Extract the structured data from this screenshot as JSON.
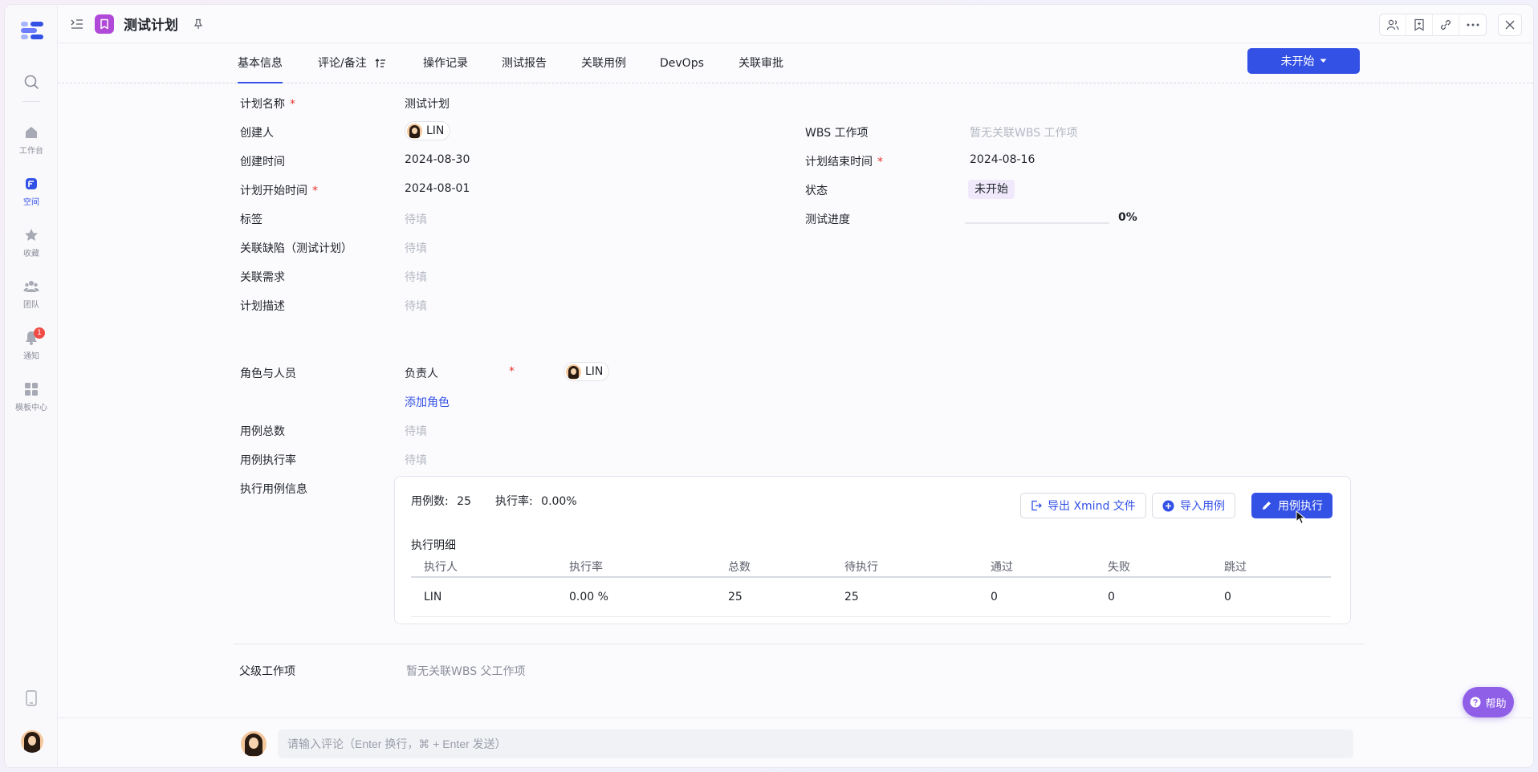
{
  "app": {
    "title": "测试计划",
    "accent_color": "#3451e6",
    "app_icon_color": "#b048d8"
  },
  "rail": {
    "items": [
      {
        "label": "工作台",
        "icon": "home-icon"
      },
      {
        "label": "空间",
        "icon": "space-icon"
      },
      {
        "label": "收藏",
        "icon": "star-icon"
      },
      {
        "label": "团队",
        "icon": "team-icon"
      },
      {
        "label": "通知",
        "icon": "bell-icon",
        "badge": "1"
      },
      {
        "label": "模板中心",
        "icon": "template-icon"
      }
    ]
  },
  "tabs": [
    {
      "label": "基本信息"
    },
    {
      "label": "评论/备注"
    },
    {
      "label": "操作记录"
    },
    {
      "label": "测试报告"
    },
    {
      "label": "关联用例"
    },
    {
      "label": "DevOps"
    },
    {
      "label": "关联审批"
    }
  ],
  "status_button": {
    "label": "未开始"
  },
  "fields_left": {
    "plan_name": {
      "label": "计划名称",
      "value": "测试计划"
    },
    "creator": {
      "label": "创建人",
      "value": "LIN"
    },
    "created_time": {
      "label": "创建时间",
      "value": "2024-08-30"
    },
    "start_time": {
      "label": "计划开始时间",
      "value": "2024-08-01"
    },
    "tags": {
      "label": "标签",
      "placeholder": "待填"
    },
    "related_bugs": {
      "label": "关联缺陷（测试计划）",
      "placeholder": "待填"
    },
    "related_reqs": {
      "label": "关联需求",
      "placeholder": "待填"
    },
    "description": {
      "label": "计划描述",
      "placeholder": "待填"
    }
  },
  "fields_right": {
    "wbs": {
      "label": "WBS 工作项",
      "placeholder": "暂无关联WBS 工作项"
    },
    "end_time": {
      "label": "计划结束时间",
      "value": "2024-08-16"
    },
    "status": {
      "label": "状态",
      "value": "未开始"
    },
    "progress": {
      "label": "测试进度",
      "value": "0%",
      "fraction": 0
    }
  },
  "roles": {
    "label": "角色与人员",
    "owner_label": "负责人",
    "owner_value": "LIN",
    "add_role": "添加角色"
  },
  "case_total": {
    "label": "用例总数",
    "placeholder": "待填"
  },
  "case_rate": {
    "label": "用例执行率",
    "placeholder": "待填"
  },
  "exec_info": {
    "label": "执行用例信息",
    "case_count_label": "用例数:",
    "case_count": "25",
    "exec_rate_label": "执行率:",
    "exec_rate": "0.00%",
    "export_label": "导出 Xmind 文件",
    "import_label": "导入用例",
    "execute_label": "用例执行",
    "detail_title": "执行明细",
    "columns": [
      "执行人",
      "执行率",
      "总数",
      "待执行",
      "通过",
      "失败",
      "跳过"
    ],
    "rows": [
      [
        "LIN",
        "0.00 %",
        "25",
        "25",
        "0",
        "0",
        "0"
      ]
    ]
  },
  "parent": {
    "label": "父级工作项",
    "placeholder": "暂无关联WBS 父工作项"
  },
  "comment": {
    "placeholder": "请输入评论（Enter 换行，⌘ + Enter 发送）"
  },
  "help": {
    "label": "帮助"
  }
}
